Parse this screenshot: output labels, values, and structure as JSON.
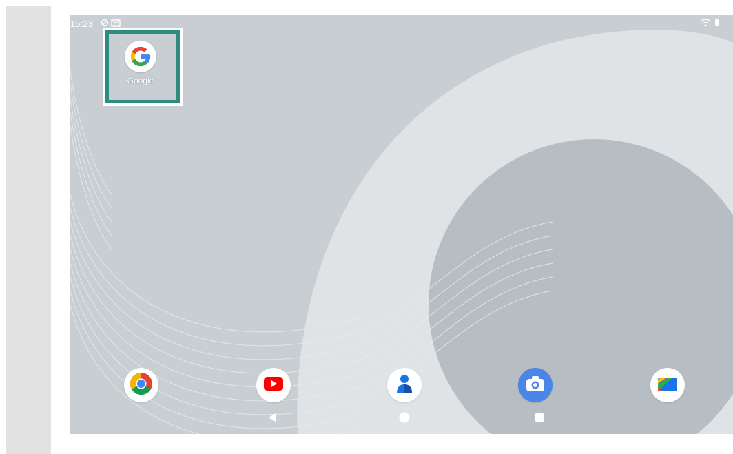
{
  "status_bar": {
    "time": "15:23",
    "icons": [
      "do-not-disturb-icon",
      "gmail-icon",
      "wifi-icon",
      "battery-icon"
    ]
  },
  "home": {
    "apps": [
      {
        "name": "google",
        "label": "Google",
        "icon": "google-g-icon"
      }
    ]
  },
  "dock": {
    "apps": [
      {
        "name": "chrome",
        "icon": "chrome-icon"
      },
      {
        "name": "youtube",
        "icon": "youtube-icon"
      },
      {
        "name": "contacts",
        "icon": "contacts-icon"
      },
      {
        "name": "camera",
        "icon": "camera-icon"
      },
      {
        "name": "files",
        "icon": "files-icon"
      }
    ]
  },
  "nav_bar": {
    "buttons": [
      "back-button",
      "home-button",
      "recents-button"
    ]
  },
  "colors": {
    "highlight": "#2e8b80",
    "google_blue": "#4285f4",
    "google_red": "#ea4335",
    "google_yellow": "#fbbc05",
    "google_green": "#34a853"
  }
}
